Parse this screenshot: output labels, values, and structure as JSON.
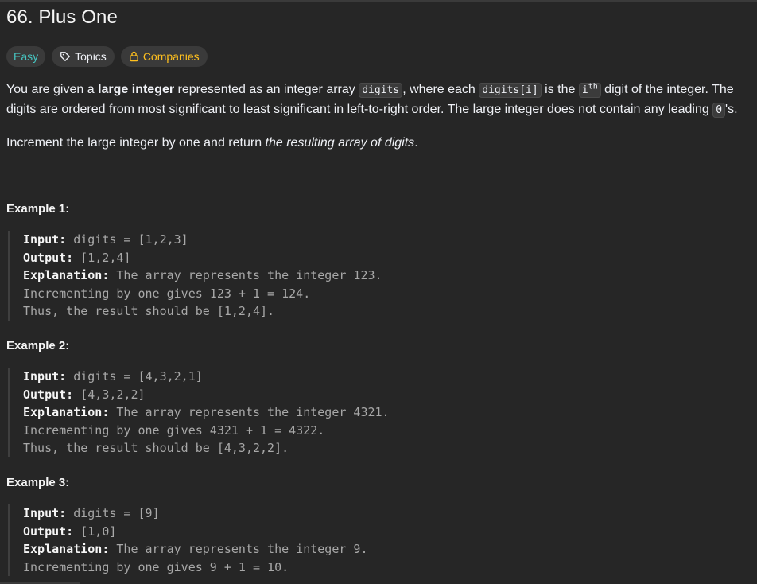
{
  "title": "66. Plus One",
  "tags": {
    "difficulty": "Easy",
    "topics": "Topics",
    "companies": "Companies"
  },
  "description": {
    "p1_a": "You are given a ",
    "p1_b": "large integer",
    "p1_c": " represented as an integer array ",
    "p1_code1": "digits",
    "p1_d": ", where each ",
    "p1_code2": "digits[i]",
    "p1_e": " is the ",
    "p1_code3": "i",
    "p1_sup": "th",
    "p1_f": " digit of the integer. The digits are ordered from most significant to least significant in left-to-right order. The large integer does not contain any leading ",
    "p1_code4": "0",
    "p1_g": "'s.",
    "p2_a": "Increment the large integer by one and return ",
    "p2_b": "the resulting array of digits",
    "p2_c": "."
  },
  "examples": [
    {
      "title": "Example 1:",
      "input_label": "Input:",
      "input": " digits = [1,2,3]",
      "output_label": "Output:",
      "output": " [1,2,4]",
      "explanation_label": "Explanation:",
      "explanation": [
        " The array represents the integer 123.",
        "Incrementing by one gives 123 + 1 = 124.",
        "Thus, the result should be [1,2,4]."
      ]
    },
    {
      "title": "Example 2:",
      "input_label": "Input:",
      "input": " digits = [4,3,2,1]",
      "output_label": "Output:",
      "output": " [4,3,2,2]",
      "explanation_label": "Explanation:",
      "explanation": [
        " The array represents the integer 4321.",
        "Incrementing by one gives 4321 + 1 = 4322.",
        "Thus, the result should be [4,3,2,2]."
      ]
    },
    {
      "title": "Example 3:",
      "input_label": "Input:",
      "input": " digits = [9]",
      "output_label": "Output:",
      "output": " [1,0]",
      "explanation_label": "Explanation:",
      "explanation": [
        " The array represents the integer 9.",
        "Incrementing by one gives 9 + 1 = 10."
      ]
    }
  ],
  "colors": {
    "background": "#262626",
    "easy": "#46c6c2",
    "companies": "#ffc01e"
  },
  "icons": {
    "topics": "tag-icon",
    "companies": "lock-icon"
  }
}
